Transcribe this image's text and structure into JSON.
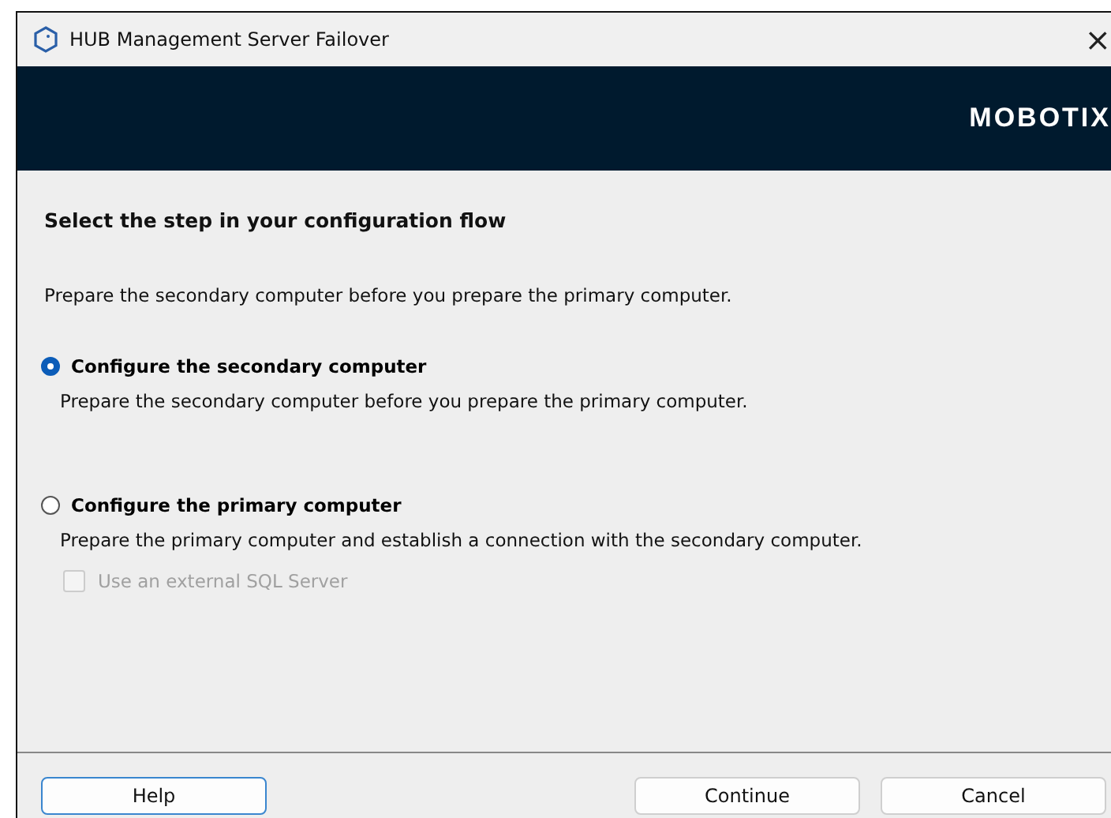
{
  "window": {
    "title": "HUB Management Server Failover",
    "close": "×"
  },
  "banner": {
    "logo": "MOBOTIX"
  },
  "heading": "Select the step in your configuration flow",
  "intro": "Prepare the secondary computer before you prepare the primary computer.",
  "options": [
    {
      "label": "Configure the secondary computer",
      "description": "Prepare the secondary computer before you prepare the primary computer.",
      "selected": true
    },
    {
      "label": "Configure the primary computer",
      "description": "Prepare the primary computer and establish a connection with the secondary computer.",
      "selected": false,
      "checkbox": {
        "label": "Use an external SQL Server",
        "checked": false,
        "disabled": true
      }
    }
  ],
  "buttons": [
    {
      "label": "Help",
      "focused": true
    },
    {
      "label": "Continue",
      "focused": false
    },
    {
      "label": "Cancel",
      "focused": false
    }
  ]
}
